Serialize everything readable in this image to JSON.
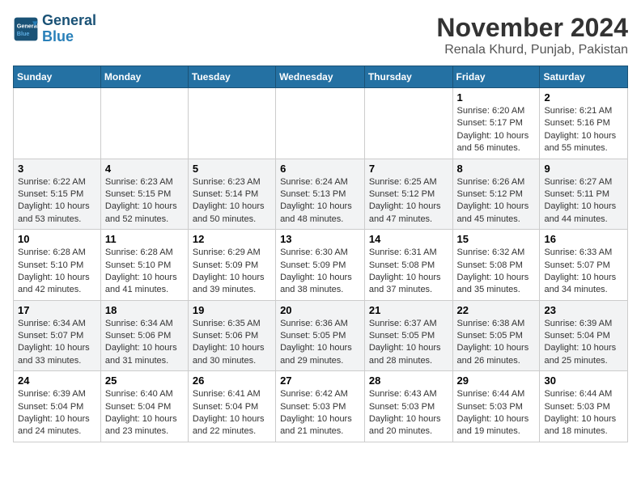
{
  "header": {
    "logo_line1": "General",
    "logo_line2": "Blue",
    "month_year": "November 2024",
    "location": "Renala Khurd, Punjab, Pakistan"
  },
  "days_of_week": [
    "Sunday",
    "Monday",
    "Tuesday",
    "Wednesday",
    "Thursday",
    "Friday",
    "Saturday"
  ],
  "weeks": [
    [
      {
        "day": "",
        "info": ""
      },
      {
        "day": "",
        "info": ""
      },
      {
        "day": "",
        "info": ""
      },
      {
        "day": "",
        "info": ""
      },
      {
        "day": "",
        "info": ""
      },
      {
        "day": "1",
        "info": "Sunrise: 6:20 AM\nSunset: 5:17 PM\nDaylight: 10 hours and 56 minutes."
      },
      {
        "day": "2",
        "info": "Sunrise: 6:21 AM\nSunset: 5:16 PM\nDaylight: 10 hours and 55 minutes."
      }
    ],
    [
      {
        "day": "3",
        "info": "Sunrise: 6:22 AM\nSunset: 5:15 PM\nDaylight: 10 hours and 53 minutes."
      },
      {
        "day": "4",
        "info": "Sunrise: 6:23 AM\nSunset: 5:15 PM\nDaylight: 10 hours and 52 minutes."
      },
      {
        "day": "5",
        "info": "Sunrise: 6:23 AM\nSunset: 5:14 PM\nDaylight: 10 hours and 50 minutes."
      },
      {
        "day": "6",
        "info": "Sunrise: 6:24 AM\nSunset: 5:13 PM\nDaylight: 10 hours and 48 minutes."
      },
      {
        "day": "7",
        "info": "Sunrise: 6:25 AM\nSunset: 5:12 PM\nDaylight: 10 hours and 47 minutes."
      },
      {
        "day": "8",
        "info": "Sunrise: 6:26 AM\nSunset: 5:12 PM\nDaylight: 10 hours and 45 minutes."
      },
      {
        "day": "9",
        "info": "Sunrise: 6:27 AM\nSunset: 5:11 PM\nDaylight: 10 hours and 44 minutes."
      }
    ],
    [
      {
        "day": "10",
        "info": "Sunrise: 6:28 AM\nSunset: 5:10 PM\nDaylight: 10 hours and 42 minutes."
      },
      {
        "day": "11",
        "info": "Sunrise: 6:28 AM\nSunset: 5:10 PM\nDaylight: 10 hours and 41 minutes."
      },
      {
        "day": "12",
        "info": "Sunrise: 6:29 AM\nSunset: 5:09 PM\nDaylight: 10 hours and 39 minutes."
      },
      {
        "day": "13",
        "info": "Sunrise: 6:30 AM\nSunset: 5:09 PM\nDaylight: 10 hours and 38 minutes."
      },
      {
        "day": "14",
        "info": "Sunrise: 6:31 AM\nSunset: 5:08 PM\nDaylight: 10 hours and 37 minutes."
      },
      {
        "day": "15",
        "info": "Sunrise: 6:32 AM\nSunset: 5:08 PM\nDaylight: 10 hours and 35 minutes."
      },
      {
        "day": "16",
        "info": "Sunrise: 6:33 AM\nSunset: 5:07 PM\nDaylight: 10 hours and 34 minutes."
      }
    ],
    [
      {
        "day": "17",
        "info": "Sunrise: 6:34 AM\nSunset: 5:07 PM\nDaylight: 10 hours and 33 minutes."
      },
      {
        "day": "18",
        "info": "Sunrise: 6:34 AM\nSunset: 5:06 PM\nDaylight: 10 hours and 31 minutes."
      },
      {
        "day": "19",
        "info": "Sunrise: 6:35 AM\nSunset: 5:06 PM\nDaylight: 10 hours and 30 minutes."
      },
      {
        "day": "20",
        "info": "Sunrise: 6:36 AM\nSunset: 5:05 PM\nDaylight: 10 hours and 29 minutes."
      },
      {
        "day": "21",
        "info": "Sunrise: 6:37 AM\nSunset: 5:05 PM\nDaylight: 10 hours and 28 minutes."
      },
      {
        "day": "22",
        "info": "Sunrise: 6:38 AM\nSunset: 5:05 PM\nDaylight: 10 hours and 26 minutes."
      },
      {
        "day": "23",
        "info": "Sunrise: 6:39 AM\nSunset: 5:04 PM\nDaylight: 10 hours and 25 minutes."
      }
    ],
    [
      {
        "day": "24",
        "info": "Sunrise: 6:39 AM\nSunset: 5:04 PM\nDaylight: 10 hours and 24 minutes."
      },
      {
        "day": "25",
        "info": "Sunrise: 6:40 AM\nSunset: 5:04 PM\nDaylight: 10 hours and 23 minutes."
      },
      {
        "day": "26",
        "info": "Sunrise: 6:41 AM\nSunset: 5:04 PM\nDaylight: 10 hours and 22 minutes."
      },
      {
        "day": "27",
        "info": "Sunrise: 6:42 AM\nSunset: 5:03 PM\nDaylight: 10 hours and 21 minutes."
      },
      {
        "day": "28",
        "info": "Sunrise: 6:43 AM\nSunset: 5:03 PM\nDaylight: 10 hours and 20 minutes."
      },
      {
        "day": "29",
        "info": "Sunrise: 6:44 AM\nSunset: 5:03 PM\nDaylight: 10 hours and 19 minutes."
      },
      {
        "day": "30",
        "info": "Sunrise: 6:44 AM\nSunset: 5:03 PM\nDaylight: 10 hours and 18 minutes."
      }
    ]
  ]
}
